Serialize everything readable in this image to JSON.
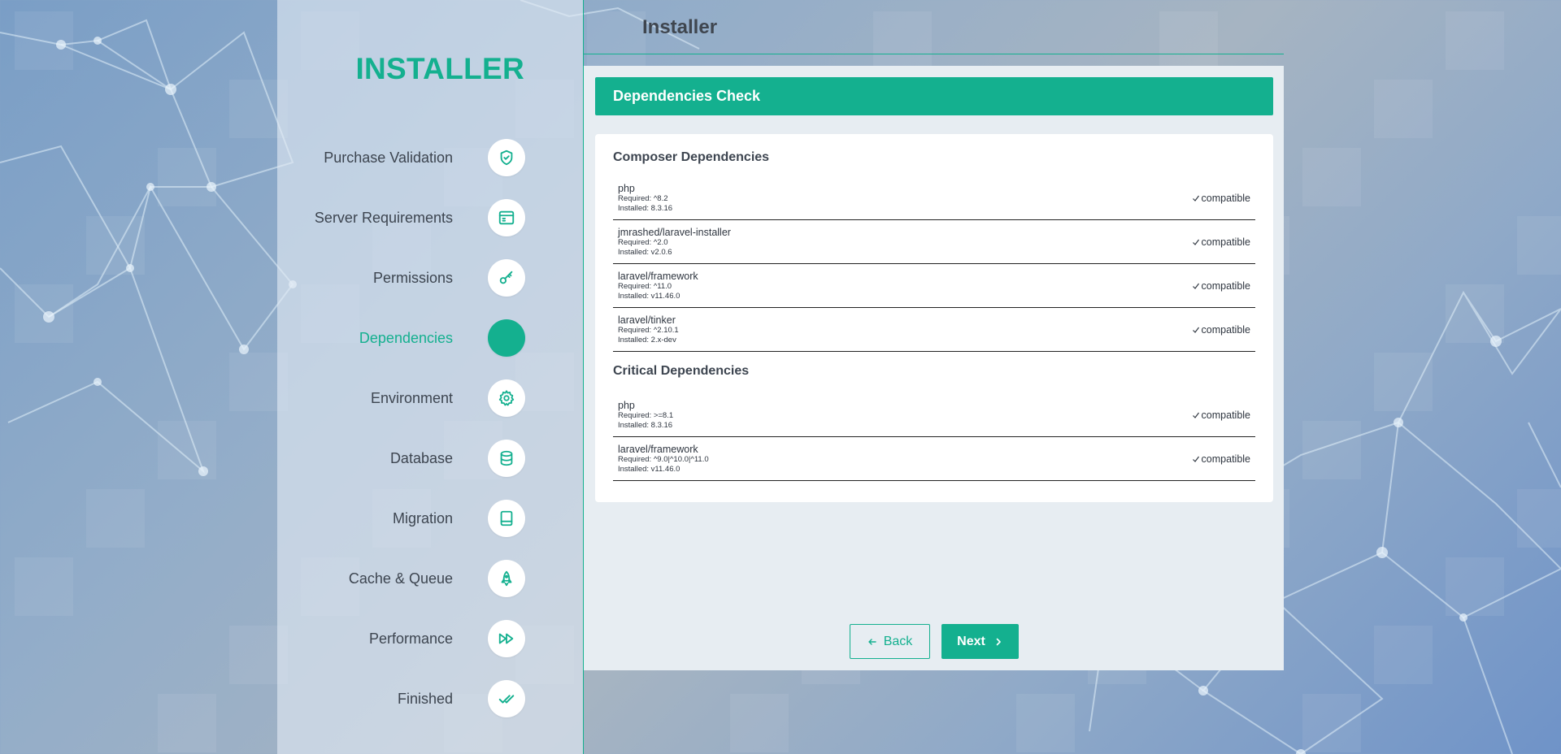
{
  "app": {
    "brand": "INSTALLER",
    "header_title": "Installer"
  },
  "colors": {
    "accent": "#14b08f",
    "panel_bg": "#e7edf2",
    "text": "#3d4550"
  },
  "steps": [
    {
      "label": "Purchase Validation",
      "icon": "shield-check-icon",
      "active": false
    },
    {
      "label": "Server Requirements",
      "icon": "browser-window-icon",
      "active": false
    },
    {
      "label": "Permissions",
      "icon": "key-icon",
      "active": false
    },
    {
      "label": "Dependencies",
      "icon": "filled-circle-icon",
      "active": true
    },
    {
      "label": "Environment",
      "icon": "gear-icon",
      "active": false
    },
    {
      "label": "Database",
      "icon": "database-icon",
      "active": false
    },
    {
      "label": "Migration",
      "icon": "tablet-icon",
      "active": false
    },
    {
      "label": "Cache & Queue",
      "icon": "rocket-icon",
      "active": false
    },
    {
      "label": "Performance",
      "icon": "fast-forward-icon",
      "active": false
    },
    {
      "label": "Finished",
      "icon": "double-check-icon",
      "active": false
    }
  ],
  "main": {
    "section_title": "Dependencies Check",
    "composer_title": "Composer Dependencies",
    "composer": [
      {
        "name": "php",
        "required": "Required: ^8.2",
        "installed": "Installed: 8.3.16",
        "status": "compatible"
      },
      {
        "name": "jmrashed/laravel-installer",
        "required": "Required: ^2.0",
        "installed": "Installed: v2.0.6",
        "status": "compatible"
      },
      {
        "name": "laravel/framework",
        "required": "Required: ^11.0",
        "installed": "Installed: v11.46.0",
        "status": "compatible"
      },
      {
        "name": "laravel/tinker",
        "required": "Required: ^2.10.1",
        "installed": "Installed: 2.x-dev",
        "status": "compatible"
      }
    ],
    "critical_title": "Critical Dependencies",
    "critical": [
      {
        "name": "php",
        "required": "Required: >=8.1",
        "installed": "Installed: 8.3.16",
        "status": "compatible"
      },
      {
        "name": "laravel/framework",
        "required": "Required: ^9.0|^10.0|^11.0",
        "installed": "Installed: v11.46.0",
        "status": "compatible"
      }
    ]
  },
  "buttons": {
    "back": "Back",
    "next": "Next"
  }
}
